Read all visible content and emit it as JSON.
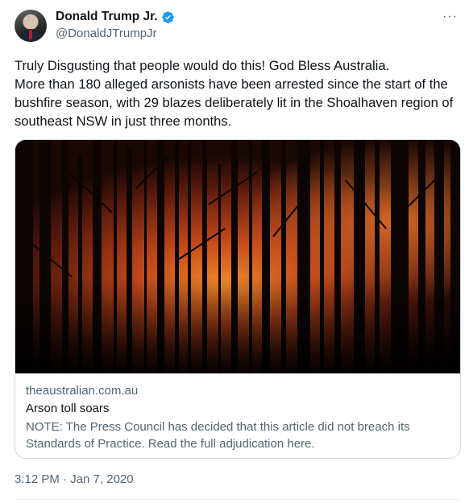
{
  "author": {
    "display_name": "Donald Trump Jr.",
    "handle": "@DonaldJTrumpJr",
    "verified": true
  },
  "menu": {
    "more_label": "···"
  },
  "tweet": {
    "text": "Truly Disgusting that people would do this! God Bless Australia.\nMore than 180 alleged arsonists have been arrested since the start of the bushfire season, with 29 blazes deliberately lit in the Shoalhaven region of southeast NSW in just three months."
  },
  "card": {
    "domain": "theaustralian.com.au",
    "title": "Arson toll soars",
    "description": "NOTE: The Press Council has decided that this article did not breach its Standards of Practice. Read the full adjudication here."
  },
  "meta": {
    "timestamp": "3:12 PM · Jan 7, 2020"
  },
  "colors": {
    "verified_blue": "#1d9bf0",
    "secondary_text": "#536471",
    "fire_orange": "#e0611a"
  },
  "icons": {
    "verified": "verified-badge-icon",
    "more": "more-options-icon"
  }
}
